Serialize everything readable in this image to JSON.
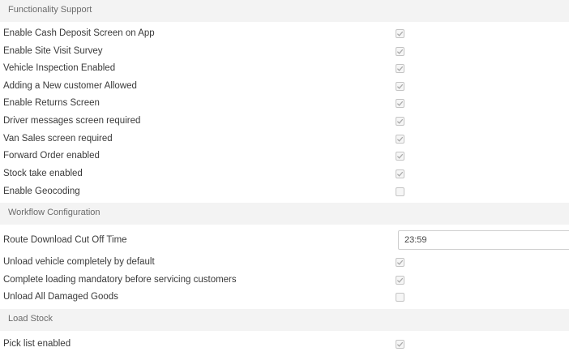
{
  "functionality": {
    "title": "Functionality Support",
    "items": [
      {
        "label": "Enable Cash Deposit Screen on App",
        "checked": true
      },
      {
        "label": "Enable Site Visit Survey",
        "checked": true
      },
      {
        "label": "Vehicle Inspection Enabled",
        "checked": true
      },
      {
        "label": "Adding a New customer Allowed",
        "checked": true
      },
      {
        "label": "Enable Returns Screen",
        "checked": true
      },
      {
        "label": "Driver messages screen required",
        "checked": true
      },
      {
        "label": "Van Sales screen required",
        "checked": true
      },
      {
        "label": "Forward Order enabled",
        "checked": true
      },
      {
        "label": "Stock take enabled",
        "checked": true
      },
      {
        "label": "Enable Geocoding",
        "checked": false
      }
    ]
  },
  "workflow": {
    "title": "Workflow Configuration",
    "cutoff_label": "Route Download Cut Off Time",
    "cutoff_value": "23:59",
    "items": [
      {
        "label": "Unload vehicle completely by default",
        "checked": true
      },
      {
        "label": "Complete loading mandatory before servicing customers",
        "checked": true
      },
      {
        "label": "Unload All Damaged Goods",
        "checked": false
      }
    ]
  },
  "load_stock": {
    "title": "Load Stock",
    "items": [
      {
        "label": "Pick list enabled",
        "checked": true
      }
    ]
  }
}
